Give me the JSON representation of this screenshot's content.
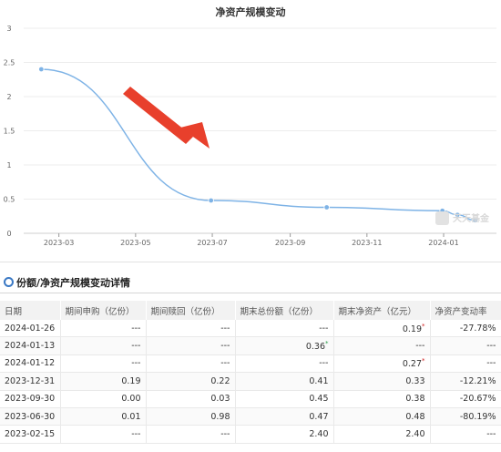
{
  "chart": {
    "title": "净资产规模变动"
  },
  "chart_data": {
    "type": "line",
    "title": "净资产规模变动",
    "xlabel": "",
    "ylabel": "",
    "ylim": [
      0,
      3
    ],
    "yticks": [
      "0",
      "0.5",
      "1",
      "1.5",
      "2",
      "2.5",
      "3"
    ],
    "xticks": [
      "2023-03",
      "2023-05",
      "2023-07",
      "2023-09",
      "2023-11",
      "2024-01"
    ],
    "x": [
      "2023-02-15",
      "2023-06-30",
      "2023-09-30",
      "2023-12-31",
      "2024-01-12",
      "2024-01-26"
    ],
    "values": [
      2.4,
      0.48,
      0.38,
      0.33,
      0.27,
      0.19
    ],
    "grid": true,
    "line_color": "#7eb3e6"
  },
  "watermark": "天天基金",
  "section": {
    "title": "份额/净资产规模变动详情"
  },
  "table": {
    "headers": [
      "日期",
      "期间申购（亿份）",
      "期间赎回（亿份）",
      "期末总份额（亿份）",
      "期末净资产（亿元）",
      "净资产变动率"
    ],
    "rows": [
      [
        "2024-01-26",
        "---",
        "---",
        "---",
        "0.19",
        "-27.78%"
      ],
      [
        "2024-01-13",
        "---",
        "---",
        "0.36",
        "---",
        "---"
      ],
      [
        "2024-01-12",
        "---",
        "---",
        "---",
        "0.27",
        "---"
      ],
      [
        "2023-12-31",
        "0.19",
        "0.22",
        "0.41",
        "0.33",
        "-12.21%"
      ],
      [
        "2023-09-30",
        "0.00",
        "0.03",
        "0.45",
        "0.38",
        "-20.67%"
      ],
      [
        "2023-06-30",
        "0.01",
        "0.98",
        "0.47",
        "0.48",
        "-80.19%"
      ],
      [
        "2023-02-15",
        "---",
        "---",
        "2.40",
        "2.40",
        "---"
      ]
    ],
    "star_marks": [
      {
        "row": 0,
        "col": 4,
        "color": "red"
      },
      {
        "row": 1,
        "col": 3,
        "color": "green"
      },
      {
        "row": 2,
        "col": 4,
        "color": "red"
      }
    ]
  },
  "colors": {
    "accent_arrow": "#e8402c",
    "line": "#7eb3e6",
    "section_icon": "#3b79c4"
  }
}
